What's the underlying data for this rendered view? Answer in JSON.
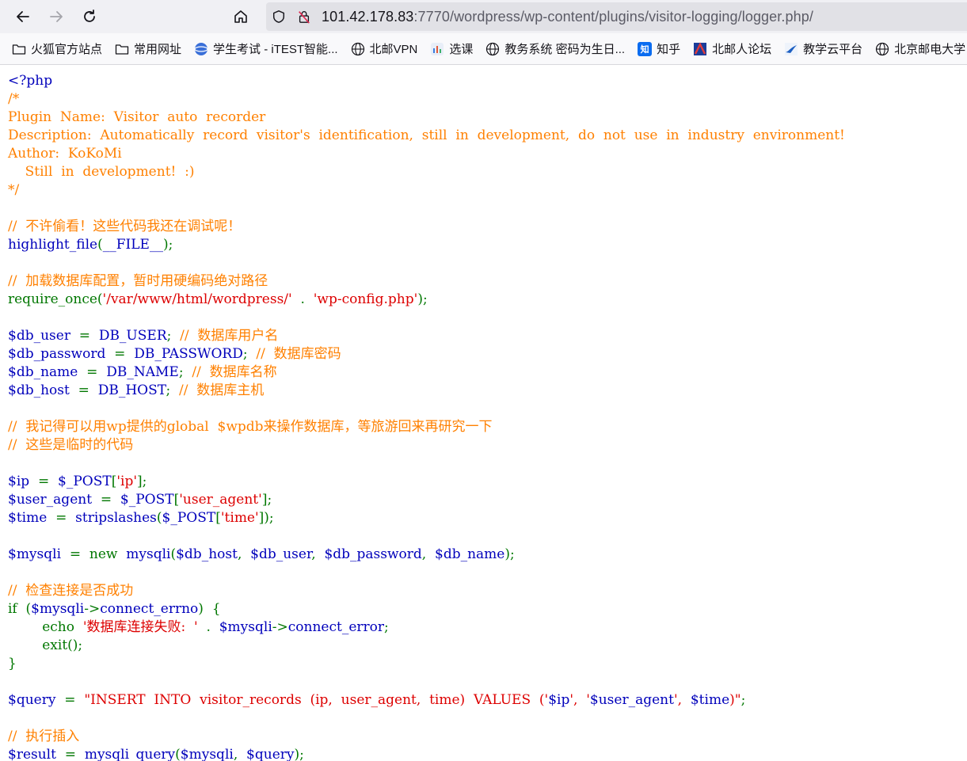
{
  "browser": {
    "url_host": "101.42.178.83",
    "url_rest": ":7770/wordpress/wp-content/plugins/visitor-logging/logger.php/"
  },
  "bookmarks": [
    {
      "label": "火狐官方站点",
      "icon": "folder-icon"
    },
    {
      "label": "常用网址",
      "icon": "folder-icon"
    },
    {
      "label": "学生考试 - iTEST智能...",
      "icon": "itest-favicon"
    },
    {
      "label": "北邮VPN",
      "icon": "globe-icon"
    },
    {
      "label": "选课",
      "icon": "xuanke-favicon"
    },
    {
      "label": "教务系统 密码为生日...",
      "icon": "globe-icon"
    },
    {
      "label": "知乎",
      "icon": "zhihu-favicon"
    },
    {
      "label": "北邮人论坛",
      "icon": "byr-favicon"
    },
    {
      "label": "教学云平台",
      "icon": "cloud-favicon"
    },
    {
      "label": "北京邮电大学",
      "icon": "globe-icon"
    }
  ],
  "code_lines": [
    [
      [
        "d",
        "<?php"
      ]
    ],
    [
      [
        "c",
        "/*"
      ]
    ],
    [
      [
        "c",
        "Plugin  Name:  Visitor  auto  recorder"
      ]
    ],
    [
      [
        "c",
        "Description:  Automatically  record  visitor's  identification,  still  in  development,  do  not  use  in  industry  environment!"
      ]
    ],
    [
      [
        "c",
        "Author:  KoKoMi"
      ]
    ],
    [
      [
        "c",
        "    Still  in  development!  :)"
      ]
    ],
    [
      [
        "c",
        "*/"
      ]
    ],
    [],
    [
      [
        "c",
        "//  不许偷看！这些代码我还在调试呢！"
      ]
    ],
    [
      [
        "d",
        "highlight_file"
      ],
      [
        "k",
        "("
      ],
      [
        "d",
        "__FILE__"
      ],
      [
        "k",
        ");"
      ]
    ],
    [],
    [
      [
        "c",
        "//  加载数据库配置，暂时用硬编码绝对路径"
      ]
    ],
    [
      [
        "k",
        "require_once("
      ],
      [
        "s",
        "'/var/www/html/wordpress/'"
      ],
      [
        "k",
        "  .  "
      ],
      [
        "s",
        "'wp-config.php'"
      ],
      [
        "k",
        ");"
      ]
    ],
    [],
    [
      [
        "d",
        "$db_user  "
      ],
      [
        "k",
        "=  "
      ],
      [
        "d",
        "DB_USER"
      ],
      [
        "k",
        ";  "
      ],
      [
        "c",
        "//  数据库用户名"
      ]
    ],
    [
      [
        "d",
        "$db_password  "
      ],
      [
        "k",
        "=  "
      ],
      [
        "d",
        "DB_PASSWORD"
      ],
      [
        "k",
        ";  "
      ],
      [
        "c",
        "//  数据库密码"
      ]
    ],
    [
      [
        "d",
        "$db_name  "
      ],
      [
        "k",
        "=  "
      ],
      [
        "d",
        "DB_NAME"
      ],
      [
        "k",
        ";  "
      ],
      [
        "c",
        "//  数据库名称"
      ]
    ],
    [
      [
        "d",
        "$db_host  "
      ],
      [
        "k",
        "=  "
      ],
      [
        "d",
        "DB_HOST"
      ],
      [
        "k",
        ";  "
      ],
      [
        "c",
        "//  数据库主机"
      ]
    ],
    [],
    [
      [
        "c",
        "//  我记得可以用wp提供的global  $wpdb来操作数据库，等旅游回来再研究一下"
      ]
    ],
    [
      [
        "c",
        "//  这些是临时的代码"
      ]
    ],
    [],
    [
      [
        "d",
        "$ip  "
      ],
      [
        "k",
        "=  "
      ],
      [
        "d",
        "$_POST"
      ],
      [
        "k",
        "["
      ],
      [
        "s",
        "'ip'"
      ],
      [
        "k",
        "];"
      ]
    ],
    [
      [
        "d",
        "$user_agent  "
      ],
      [
        "k",
        "=  "
      ],
      [
        "d",
        "$_POST"
      ],
      [
        "k",
        "["
      ],
      [
        "s",
        "'user_agent'"
      ],
      [
        "k",
        "];"
      ]
    ],
    [
      [
        "d",
        "$time  "
      ],
      [
        "k",
        "=  "
      ],
      [
        "d",
        "stripslashes"
      ],
      [
        "k",
        "("
      ],
      [
        "d",
        "$_POST"
      ],
      [
        "k",
        "["
      ],
      [
        "s",
        "'time'"
      ],
      [
        "k",
        "]);"
      ]
    ],
    [],
    [
      [
        "d",
        "$mysqli  "
      ],
      [
        "k",
        "=  new  "
      ],
      [
        "d",
        "mysqli"
      ],
      [
        "k",
        "("
      ],
      [
        "d",
        "$db_host"
      ],
      [
        "k",
        ",  "
      ],
      [
        "d",
        "$db_user"
      ],
      [
        "k",
        ",  "
      ],
      [
        "d",
        "$db_password"
      ],
      [
        "k",
        ",  "
      ],
      [
        "d",
        "$db_name"
      ],
      [
        "k",
        ");"
      ]
    ],
    [],
    [
      [
        "c",
        "//  检查连接是否成功"
      ]
    ],
    [
      [
        "k",
        "if  ("
      ],
      [
        "d",
        "$mysqli"
      ],
      [
        "k",
        "->"
      ],
      [
        "d",
        "connect_errno"
      ],
      [
        "k",
        ")  {"
      ]
    ],
    [
      [
        "k",
        "        echo  "
      ],
      [
        "s",
        "'数据库连接失败:  '  "
      ],
      [
        "k",
        ".  "
      ],
      [
        "d",
        "$mysqli"
      ],
      [
        "k",
        "->"
      ],
      [
        "d",
        "connect_error"
      ],
      [
        "k",
        ";"
      ]
    ],
    [
      [
        "k",
        "        exit();"
      ]
    ],
    [
      [
        "k",
        "}"
      ]
    ],
    [],
    [
      [
        "d",
        "$query  "
      ],
      [
        "k",
        "=  "
      ],
      [
        "s",
        "\"INSERT  INTO  visitor_records  (ip,  user_agent,  time)  VALUES  ('"
      ],
      [
        "d",
        "$ip"
      ],
      [
        "s",
        "',  '"
      ],
      [
        "d",
        "$user_agent"
      ],
      [
        "s",
        "',  "
      ],
      [
        "d",
        "$time"
      ],
      [
        "s",
        ")\""
      ],
      [
        "k",
        ";"
      ]
    ],
    [],
    [
      [
        "c",
        "//  执行插入"
      ]
    ],
    [
      [
        "d",
        "$result  "
      ],
      [
        "k",
        "=  "
      ],
      [
        "d",
        "mysqli_query"
      ],
      [
        "k",
        "("
      ],
      [
        "d",
        "$mysqli"
      ],
      [
        "k",
        ",  "
      ],
      [
        "d",
        "$query"
      ],
      [
        "k",
        ");"
      ]
    ]
  ]
}
